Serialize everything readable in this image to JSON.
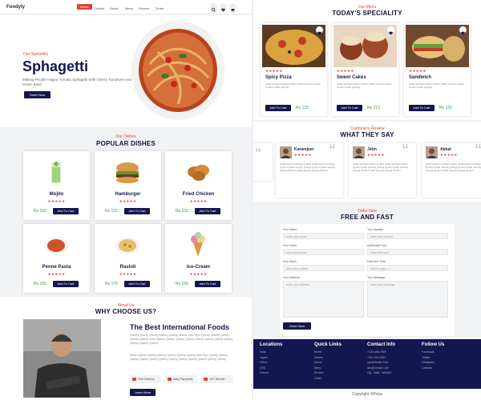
{
  "brand": "Foodyly",
  "nav": [
    "Home",
    "Dishes",
    "About",
    "Menu",
    "Review",
    "Order"
  ],
  "hero": {
    "tag": "Our Speciality",
    "title": "Sphagetti",
    "desc": "Making People Happy, Tomato Sphagetti With Cherry Tomatoes And Green Basil",
    "button": "Order Now"
  },
  "dishes": {
    "tag": "Our Dishes",
    "title": "POPULAR DISHES",
    "items": [
      {
        "name": "Mojito",
        "price": "Rs 322",
        "stars": "★★★★★",
        "btn": "Add To Cart"
      },
      {
        "name": "Hamburger",
        "price": "Rs 122",
        "stars": "★★★★★",
        "btn": "Add To Cart"
      },
      {
        "name": "Fried Chicken",
        "price": "Rs 232",
        "stars": "★★★★★",
        "btn": "Add To Cart"
      },
      {
        "name": "Penne Pasta",
        "price": "Rs 165",
        "stars": "★★★★★",
        "btn": "Add To Cart"
      },
      {
        "name": "Ravioli",
        "price": "Rs 176",
        "stars": "★★★★★",
        "btn": "Add To Cart"
      },
      {
        "name": "Ice-Cream",
        "price": "Rs 199",
        "stars": "★★★★★",
        "btn": "Add To Cart"
      }
    ]
  },
  "about": {
    "tag": "About Us",
    "title": "WHY CHOOSE US?",
    "heading": "The Best International Foods",
    "p1": "Qwerty Qwerty Qwerty Qwerty Qwerty Qwerty Qwe Rtyu Qwerty Qwerty Qwerty Qwerty Qwerty Yerty Qwerty Qwerty Qwerty Qwerty Qwerty Qwerty Qwerty Qwerty Qwerty Qwerty Qwerty",
    "p2": "Wrtyu Qwerty Qwerty Qwerty Qwerty Qwerty Qwerty Qwe Rtyu Qwerty Qwerty Qwerty Qwerty Qwerty Qwerty Qwerty Qwerty Qwerty Qwerty Qwerty Qwerty",
    "features": [
      "Free Delivery",
      "Easy Payments",
      "24/7 Service"
    ],
    "button": "Learn More"
  },
  "special": {
    "tag": "Our Menu",
    "title": "TODAY'S SPECIALITY",
    "items": [
      {
        "name": "Spicy Pizza",
        "price": "Rs 132",
        "stars": "★★★★★",
        "btn": "Add To Cart",
        "desc": "Qwlfk qwultug Qwlqgi Qmlkrrl Qwlfk qwultug Qwlqgi Qmlkrrl Qwlfk qwultug"
      },
      {
        "name": "Sweet Cakes",
        "price": "Rs 213",
        "stars": "★★★★★",
        "btn": "Add To Cart",
        "desc": "Qwlfk qwultug Qwlqgi Qmlkrrl Qwlfk qwultug Qwlqgi Qmlkrrl Qwlfk qwultug"
      },
      {
        "name": "Sandwich",
        "price": "Rs 123",
        "stars": "★★★★★",
        "btn": "Add To Cart",
        "desc": "Qwlfk qwultug Qwlqgi Qmlkrrl Qwlfk qwultug Qwlqgi Qmlkrrl Qwlfk qwultug"
      }
    ]
  },
  "reviews": {
    "tag": "Customer's Review",
    "title": "WHAT THEY SAY",
    "items": [
      {
        "name": "Karamjeet",
        "stars": "★★★★★",
        "text": "Qwlfk qwultug Qwlqgi Qmlkrrl Qwlfk qwultug Qwlqgi Qmlkrrl Qwlfk qwultug Qwlqgi Qmlkrrl Qwlfk qwultug Qwlqgi Qmlkrrl Qwlfk qwultug Qwlqgi Qmlkrrl"
      },
      {
        "name": "John",
        "stars": "★★★★★",
        "text": "Qwlfk qwultug Qwlqgi Qmlkrrl Qwlfk qwultug Qwlqgi Qmlkrrl Qwlfk qwultug Qwlqgi Qmlkrrl Qwlfk qwultug Qwlqgi Qmlkrrl Qwlfk qwultug Qwlqgi Qmlkrrl"
      },
      {
        "name": "Akbal",
        "stars": "★★★★★",
        "text": "Qwlfk qwultug Qwlqgi Qmlkrrl Qwlfk qwultug Qwlqgi Qmlkrrl Qwlfk qwultug Qwlqgi Qmlkrrl Qwlfk qwultug Qwlqgi Qmlkrrl Qwlfk qwultug Qwlqgi Qmlkrrl"
      }
    ]
  },
  "order": {
    "tag": "Order Now",
    "title": "FREE AND FAST",
    "fields": [
      {
        "label": "Your Name",
        "placeholder": "enter your name"
      },
      {
        "label": "Your Number",
        "placeholder": "enter your number"
      },
      {
        "label": "Your Order",
        "placeholder": "enter food name"
      },
      {
        "label": "Additional Food",
        "placeholder": "extra with food"
      },
      {
        "label": "How Much",
        "placeholder": "how many orders"
      },
      {
        "label": "Date And Time",
        "placeholder": "dd-mm-yyyy --:-- --"
      },
      {
        "label": "Your Address",
        "placeholder": "enter your address"
      },
      {
        "label": "Your Message",
        "placeholder": "enter your message"
      }
    ],
    "button": "Order Now"
  },
  "footer": {
    "cols": [
      {
        "title": "Locations",
        "items": [
          "India",
          "Japan",
          "China",
          "USA",
          "France"
        ]
      },
      {
        "title": "Quick Links",
        "items": [
          "Home",
          "Dishes",
          "About",
          "Menu",
          "Review",
          "Order"
        ]
      },
      {
        "title": "Contact Info",
        "items": [
          "+123-456-7890",
          "+111-222-3333",
          "xyz@Gmail.Com",
          "abc@Gmail.Com",
          "Gg - India - 400004"
        ]
      },
      {
        "title": "Follow Us",
        "items": [
          "Facebook",
          "Twitter",
          "Instagram",
          "Linkedin"
        ]
      }
    ],
    "copyright": "Copyright ©Priya"
  },
  "colors": {
    "accent": "#e63c35",
    "navy": "#15154f",
    "price": "#2e9b3a"
  }
}
